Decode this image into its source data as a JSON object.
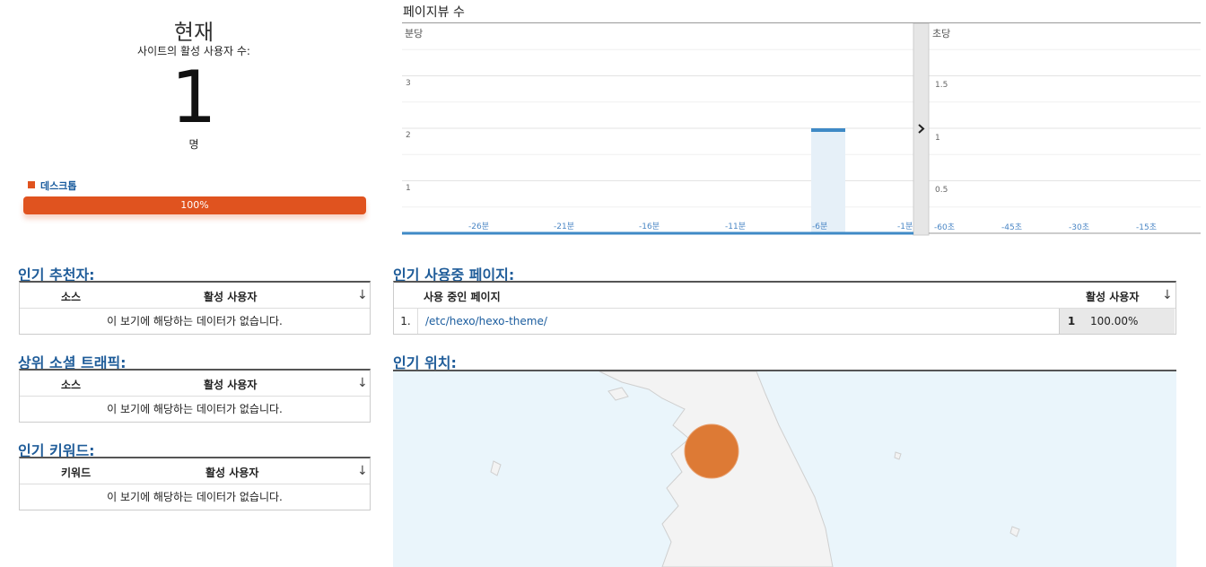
{
  "realtime": {
    "title": "현재",
    "subtitle": "사이트의 활성 사용자 수:",
    "count": "1",
    "unit": "명",
    "device_legend": "데스크톱",
    "device_percent": "100%",
    "device_fraction": 1.0,
    "device_color": "#e0531f"
  },
  "pageviews_chart": {
    "title": "페이지뷰 수",
    "per_minute_label": "분당",
    "per_second_label": "초당",
    "expand_icon": "chevron-right-icon"
  },
  "chart_data": [
    {
      "type": "bar",
      "ylabel": "분당",
      "y_ticks": [
        "1",
        "2",
        "3"
      ],
      "x_ticks": [
        "-26분",
        "-21분",
        "-16분",
        "-11분",
        "-6분",
        "-1분"
      ],
      "ylim": [
        0,
        4
      ],
      "series": [
        {
          "x": "-6분",
          "value": 2,
          "highlight": true
        }
      ],
      "bar_color": "#3f8ac6"
    },
    {
      "type": "bar",
      "ylabel": "초당",
      "y_ticks": [
        "0.5",
        "1",
        "1.5"
      ],
      "x_ticks": [
        "-60초",
        "-45초",
        "-30초",
        "-15초"
      ],
      "ylim": [
        0,
        2
      ],
      "series": []
    }
  ],
  "top_referrers": {
    "title": "인기 추천자:",
    "col_source": "소스",
    "col_users": "활성 사용자",
    "empty": "이 보기에 해당하는 데이터가 없습니다."
  },
  "top_social": {
    "title": "상위 소셜 트래픽:",
    "col_source": "소스",
    "col_users": "활성 사용자",
    "empty": "이 보기에 해당하는 데이터가 없습니다."
  },
  "top_keywords": {
    "title": "인기 키워드:",
    "col_keyword": "키워드",
    "col_users": "활성 사용자",
    "empty": "이 보기에 해당하는 데이터가 없습니다."
  },
  "top_pages": {
    "title": "인기 사용중 페이지:",
    "col_page": "사용 중인 페이지",
    "col_users": "활성 사용자",
    "rows": [
      {
        "index": "1.",
        "page": "/etc/hexo/hexo-theme/",
        "users": "1",
        "percent": "100.00%"
      }
    ]
  },
  "top_locations": {
    "title": "인기 위치:"
  },
  "colors": {
    "accent_blue": "#1f5c99",
    "desktop_orange": "#e0531f",
    "bubble_orange": "#dd7a35"
  }
}
